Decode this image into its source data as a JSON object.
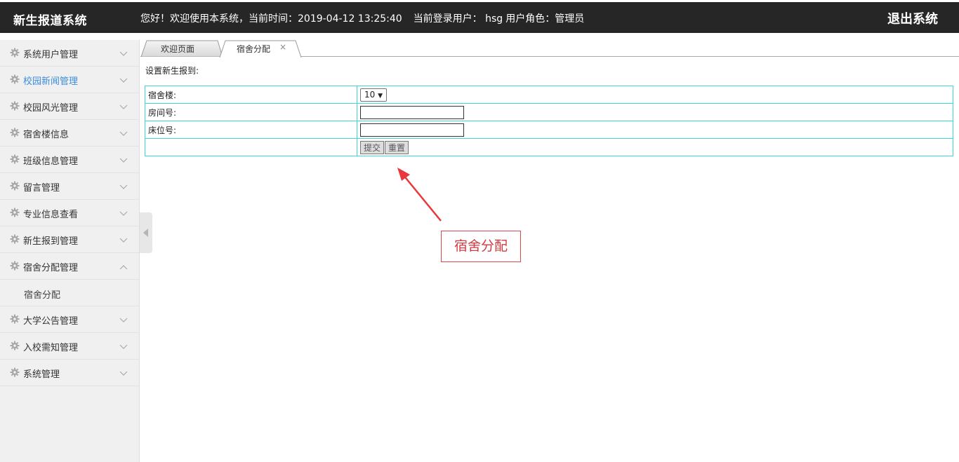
{
  "header": {
    "brand": "新生报道系统",
    "welcome_text": "您好！欢迎使用本系统，当前时间：2019-04-12 13:25:40",
    "login_user_text": "当前登录用户：  hsg",
    "role_text": "用户角色：管理员",
    "logout_label": "退出系统",
    "bg_color": "#262626"
  },
  "sidebar": {
    "items": [
      {
        "label": "系统用户管理",
        "icon": "gear-icon",
        "expanded": false
      },
      {
        "label": "校园新闻管理",
        "icon": "gear-icon",
        "expanded": false,
        "active": true
      },
      {
        "label": "校园风光管理",
        "icon": "gear-icon",
        "expanded": false
      },
      {
        "label": "宿舍楼信息",
        "icon": "gear-icon",
        "expanded": false
      },
      {
        "label": "班级信息管理",
        "icon": "gear-icon",
        "expanded": false
      },
      {
        "label": "留言管理",
        "icon": "gear-icon",
        "expanded": false
      },
      {
        "label": "专业信息查看",
        "icon": "gear-icon",
        "expanded": false
      },
      {
        "label": "新生报到管理",
        "icon": "gear-icon",
        "expanded": false
      },
      {
        "label": "宿舍分配管理",
        "icon": "gear-icon",
        "expanded": true,
        "children": [
          {
            "label": "宿舍分配"
          }
        ]
      },
      {
        "label": "大学公告管理",
        "icon": "gear-icon",
        "expanded": false
      },
      {
        "label": "入校需知管理",
        "icon": "gear-icon",
        "expanded": false
      },
      {
        "label": "系统管理",
        "icon": "gear-icon",
        "expanded": false
      }
    ],
    "active_color": "#3c8dde"
  },
  "tabs": [
    {
      "label": "欢迎页面",
      "active": false
    },
    {
      "label": "宿舍分配",
      "active": true,
      "close": "×"
    }
  ],
  "main": {
    "heading": "设置新生报到:",
    "form": {
      "dorm_label": "宿舍楼:",
      "dorm_value": "10",
      "room_label": "房间号:",
      "room_value": "",
      "bed_label": "床位号:",
      "bed_value": "",
      "submit_label": "提交",
      "reset_label": "重置",
      "border_color": "#3ed6d6"
    }
  },
  "annotation": {
    "callout_text": "宿舍分配",
    "color": "#e0474c"
  }
}
